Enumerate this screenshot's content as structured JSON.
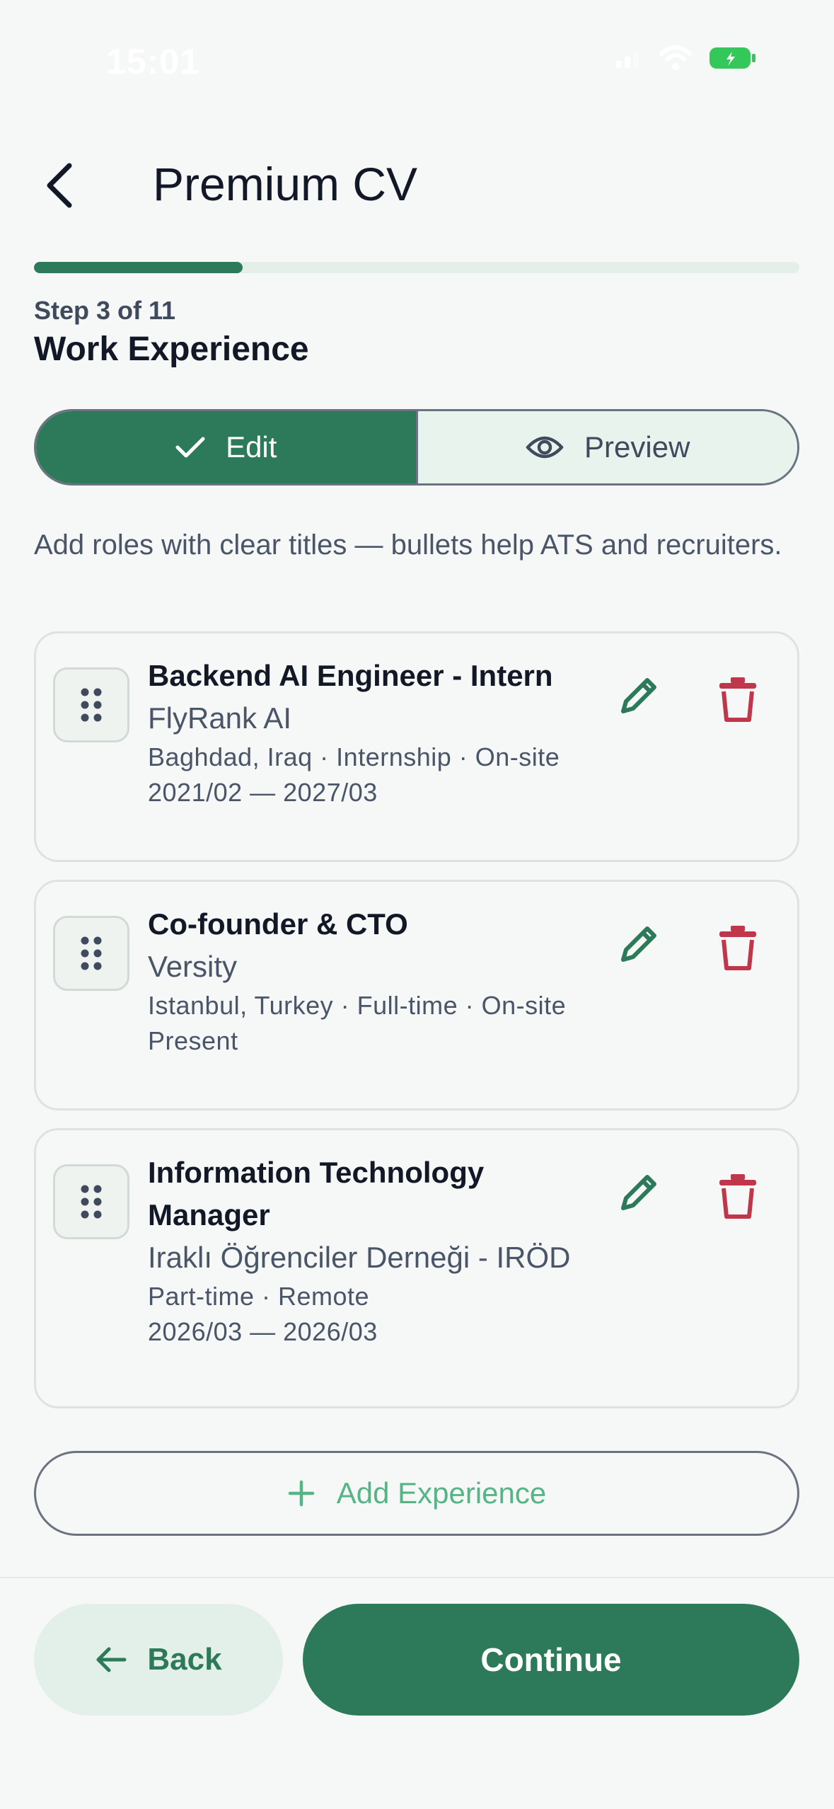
{
  "status_bar": {
    "time": "15:01"
  },
  "header": {
    "title": "Premium CV"
  },
  "progress": {
    "current_step": 3,
    "total_steps": 11,
    "fraction": 0.2727,
    "label": "Step 3 of 11"
  },
  "section": {
    "title": "Work Experience"
  },
  "toggle": {
    "edit_label": "Edit",
    "preview_label": "Preview",
    "active": "edit"
  },
  "intro_text": "Add roles with clear titles — bullets help ATS and recruiters.",
  "experiences": [
    {
      "title": "Backend AI Engineer - Intern",
      "company": "FlyRank AI",
      "details": "Baghdad, Iraq · Internship · On-site",
      "dates": "2021/02 — 2027/03"
    },
    {
      "title": "Co-founder & CTO",
      "company": "Versity",
      "details": "Istanbul, Turkey · Full-time · On-site",
      "dates": "Present"
    },
    {
      "title": "Information Technology Manager",
      "company": "Iraklı Öğrenciler Derneği - IRÖD",
      "details": "Part-time · Remote",
      "dates": "2026/03 — 2026/03"
    }
  ],
  "add_button": {
    "label": "Add Experience"
  },
  "footer": {
    "back_label": "Back",
    "continue_label": "Continue"
  },
  "colors": {
    "primary": "#2D7A5A",
    "primary_light": "#E3F0E9",
    "accent_text": "#57B487",
    "delete": "#C0364A",
    "battery": "#34C759"
  },
  "icons": {
    "back": "chevron-left-icon",
    "edit_toggle": "check-icon",
    "preview_toggle": "eye-icon",
    "drag": "drag-handle-icon",
    "edit": "pencil-icon",
    "delete": "trash-icon",
    "add": "plus-icon",
    "footer_back": "arrow-left-icon"
  }
}
